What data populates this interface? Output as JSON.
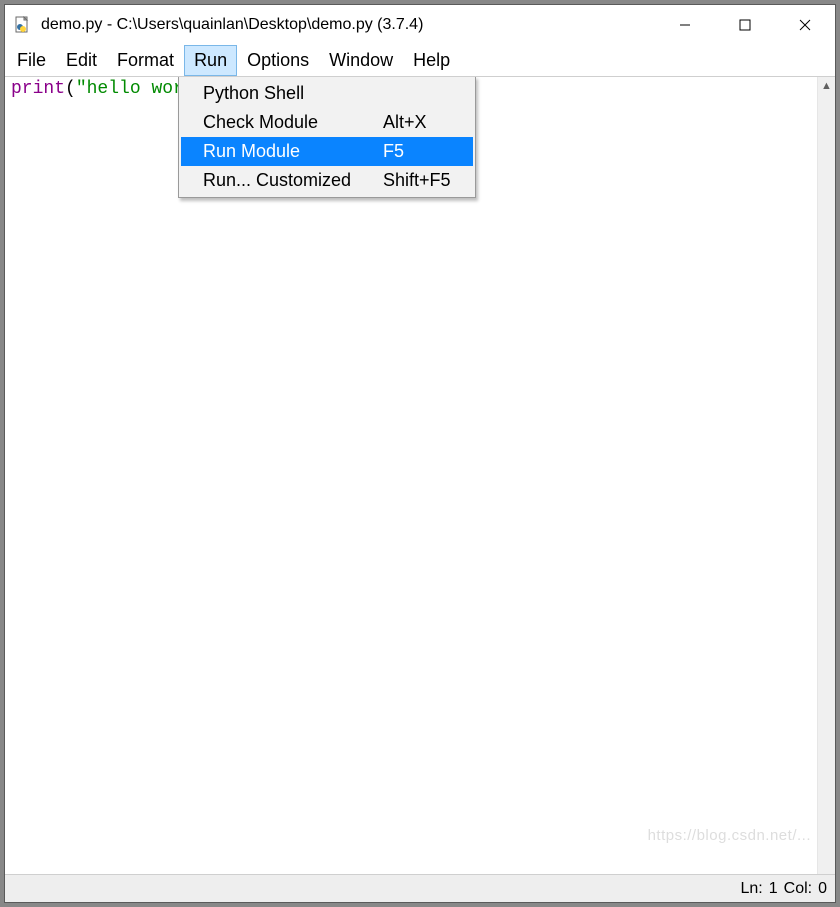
{
  "title": "demo.py - C:\\Users\\quainlan\\Desktop\\demo.py (3.7.4)",
  "icon": "python-file-icon",
  "menubar": {
    "items": [
      {
        "label": "File"
      },
      {
        "label": "Edit"
      },
      {
        "label": "Format"
      },
      {
        "label": "Run"
      },
      {
        "label": "Options"
      },
      {
        "label": "Window"
      },
      {
        "label": "Help"
      }
    ],
    "open_index": 3
  },
  "dropdown": {
    "items": [
      {
        "label": "Python Shell",
        "accel": ""
      },
      {
        "label": "Check Module",
        "accel": "Alt+X"
      },
      {
        "label": "Run Module",
        "accel": "F5"
      },
      {
        "label": "Run... Customized",
        "accel": "Shift+F5"
      }
    ],
    "selected_index": 2
  },
  "code": {
    "tokens": [
      {
        "class": "tok-builtin",
        "text": "print"
      },
      {
        "class": "",
        "text": "("
      },
      {
        "class": "tok-string",
        "text": "\"hello wor"
      }
    ]
  },
  "status": {
    "line_label": "Ln:",
    "line": "1",
    "col_label": "Col:",
    "col": "0"
  },
  "watermark": "https://blog.csdn.net/..."
}
